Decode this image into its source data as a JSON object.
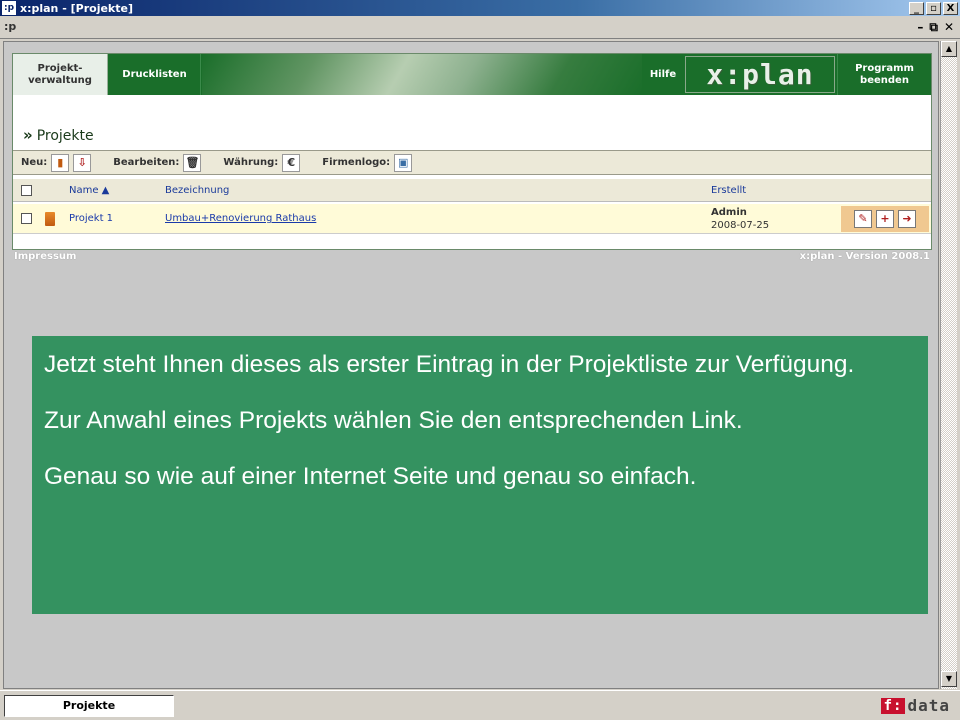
{
  "window": {
    "icon": ":p",
    "title": "x:plan - [Projekte]",
    "btn_min": "_",
    "btn_max": "▫",
    "btn_close": "X"
  },
  "mdi": {
    "icon": ":p",
    "min": "–",
    "restore": "⧉",
    "close": "✕"
  },
  "nav": {
    "projektverwaltung": "Projekt-\nverwaltung",
    "drucklisten": "Drucklisten",
    "hilfe": "Hilfe",
    "logo": "x:plan",
    "programm_beenden": "Programm\nbeenden"
  },
  "page": {
    "heading_prefix": "»",
    "heading": "Projekte"
  },
  "toolbar": {
    "neu": "Neu:",
    "bearbeiten": "Bearbeiten:",
    "waehrung": "Währung:",
    "waehrung_symbol": "€",
    "firmenlogo": "Firmenlogo:"
  },
  "table": {
    "headers": {
      "name": "Name ▲",
      "bezeichnung": "Bezeichnung",
      "erstellt": "Erstellt"
    },
    "rows": [
      {
        "name": "Projekt 1",
        "bezeichnung": "Umbau+Renovierung Rathaus",
        "created_by": "Admin",
        "created_date": "2008-07-25"
      }
    ]
  },
  "footer": {
    "left": "Impressum",
    "right": "x:plan - Version 2008.1"
  },
  "overlay": {
    "p1": "Jetzt steht Ihnen dieses als erster Eintrag in der Projektliste zur Verfügung.",
    "p2": "Zur Anwahl eines Projekts wählen Sie den entsprechenden Link.",
    "p3": "Genau so wie auf einer Internet Seite und genau so einfach."
  },
  "taskbar": {
    "tab": "Projekte",
    "brand_f": "f:",
    "brand_rest": "data"
  },
  "colors": {
    "nav_green": "#1a6e2a",
    "overlay_green": "#349260",
    "row_highlight": "#fffbd8"
  }
}
